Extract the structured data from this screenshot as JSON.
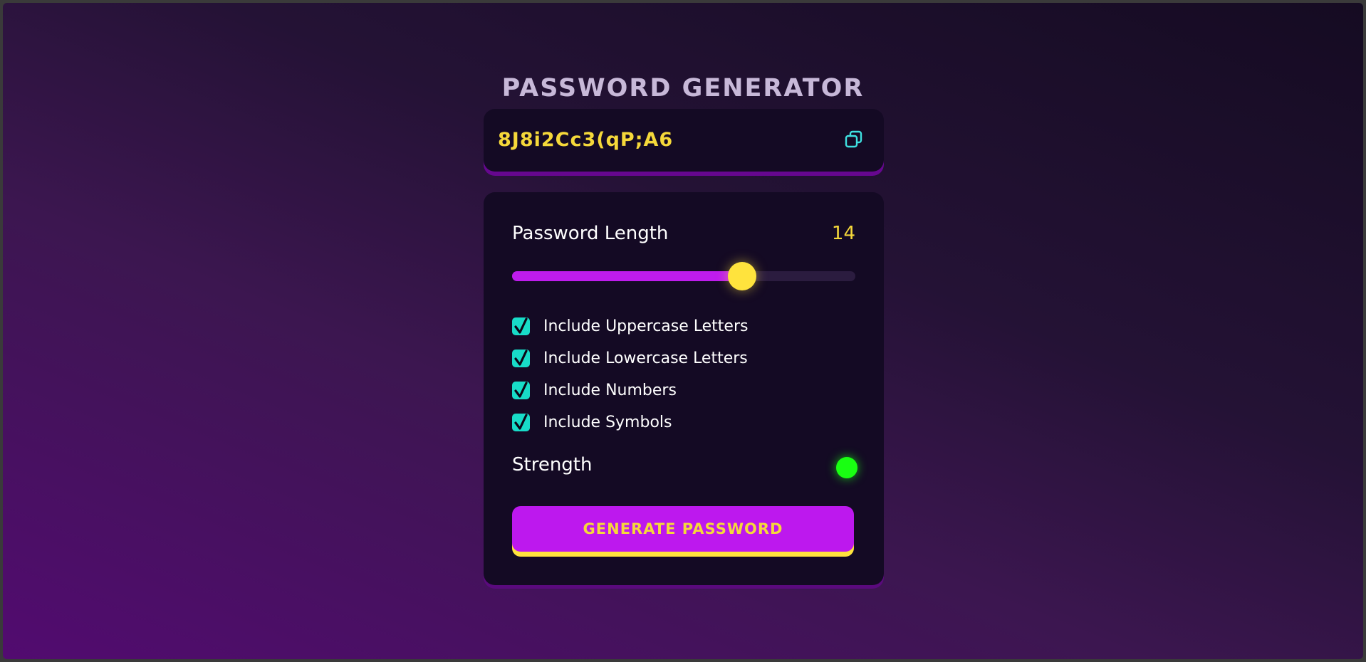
{
  "app": {
    "title": "PASSWORD GENERATOR"
  },
  "display": {
    "password": "8J8i2Cc3(qP;A6",
    "copy_icon": "copy-icon"
  },
  "length": {
    "label": "Password Length",
    "value": "14",
    "slider_fraction": 0.67
  },
  "options": [
    {
      "label": "Include Uppercase Letters",
      "checked": true
    },
    {
      "label": "Include Lowercase Letters",
      "checked": true
    },
    {
      "label": "Include Numbers",
      "checked": true
    },
    {
      "label": "Include Symbols",
      "checked": true
    }
  ],
  "strength": {
    "label": "Strength",
    "indicator_color": "#19ff12"
  },
  "generate_button": {
    "label": "GENERATE PASSWORD"
  },
  "colors": {
    "accent_purple": "#bd18ee",
    "accent_yellow": "#f5d83a",
    "checkbox_teal": "#18dcc8",
    "panel_bg": "#140a24"
  }
}
